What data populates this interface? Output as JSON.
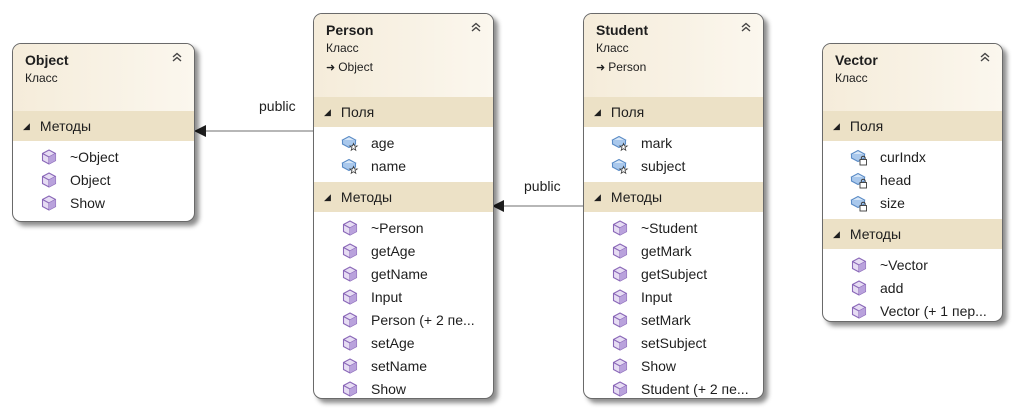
{
  "colors": {
    "header_fill": "#f5ecda",
    "section_fill": "#ece1c6",
    "border": "#6a6a6a",
    "method_icon": "#8a68b8",
    "field_icon": "#5a8bc6",
    "link": "#8c8c8c"
  },
  "links": [
    {
      "label": "public"
    },
    {
      "label": "public"
    }
  ],
  "classes": [
    {
      "name": "Object",
      "kind": "Класс",
      "sections": [
        {
          "title": "Методы",
          "items": [
            {
              "label": "~Object",
              "icon": "method-icon"
            },
            {
              "label": "Object",
              "icon": "method-icon"
            },
            {
              "label": "Show",
              "icon": "method-icon"
            }
          ]
        }
      ]
    },
    {
      "name": "Person",
      "kind": "Класс",
      "base": "Object",
      "sections": [
        {
          "title": "Поля",
          "items": [
            {
              "label": "age",
              "icon": "field-icon"
            },
            {
              "label": "name",
              "icon": "field-icon"
            }
          ]
        },
        {
          "title": "Методы",
          "items": [
            {
              "label": "~Person",
              "icon": "method-icon"
            },
            {
              "label": "getAge",
              "icon": "method-icon"
            },
            {
              "label": "getName",
              "icon": "method-icon"
            },
            {
              "label": "Input",
              "icon": "method-icon"
            },
            {
              "label": "Person (+ 2 пе...",
              "icon": "method-icon"
            },
            {
              "label": "setAge",
              "icon": "method-icon"
            },
            {
              "label": "setName",
              "icon": "method-icon"
            },
            {
              "label": "Show",
              "icon": "method-icon"
            }
          ]
        }
      ]
    },
    {
      "name": "Student",
      "kind": "Класс",
      "base": "Person",
      "sections": [
        {
          "title": "Поля",
          "items": [
            {
              "label": "mark",
              "icon": "field-icon"
            },
            {
              "label": "subject",
              "icon": "field-icon"
            }
          ]
        },
        {
          "title": "Методы",
          "items": [
            {
              "label": "~Student",
              "icon": "method-icon"
            },
            {
              "label": "getMark",
              "icon": "method-icon"
            },
            {
              "label": "getSubject",
              "icon": "method-icon"
            },
            {
              "label": "Input",
              "icon": "method-icon"
            },
            {
              "label": "setMark",
              "icon": "method-icon"
            },
            {
              "label": "setSubject",
              "icon": "method-icon"
            },
            {
              "label": "Show",
              "icon": "method-icon"
            },
            {
              "label": "Student (+ 2 пе...",
              "icon": "method-icon"
            }
          ]
        }
      ]
    },
    {
      "name": "Vector",
      "kind": "Класс",
      "sections": [
        {
          "title": "Поля",
          "items": [
            {
              "label": "curIndx",
              "icon": "private-field-icon"
            },
            {
              "label": "head",
              "icon": "private-field-icon"
            },
            {
              "label": "size",
              "icon": "private-field-icon"
            }
          ]
        },
        {
          "title": "Методы",
          "items": [
            {
              "label": "~Vector",
              "icon": "method-icon"
            },
            {
              "label": "add",
              "icon": "method-icon"
            },
            {
              "label": "Vector (+ 1 пер...",
              "icon": "method-icon"
            }
          ]
        }
      ]
    }
  ]
}
